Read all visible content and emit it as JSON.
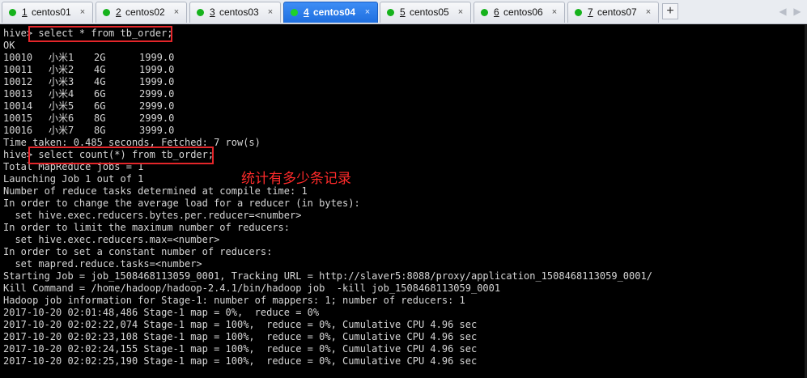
{
  "tabs": [
    {
      "num": "1",
      "name": "centos01",
      "active": false
    },
    {
      "num": "2",
      "name": "centos02",
      "active": false
    },
    {
      "num": "3",
      "name": "centos03",
      "active": false
    },
    {
      "num": "4",
      "name": "centos04",
      "active": true
    },
    {
      "num": "5",
      "name": "centos05",
      "active": false
    },
    {
      "num": "6",
      "name": "centos06",
      "active": false
    },
    {
      "num": "7",
      "name": "centos07",
      "active": false
    }
  ],
  "tab_close_glyph": "×",
  "new_tab_glyph": "+",
  "nav": {
    "left": "◀",
    "right": "▶"
  },
  "terminal": {
    "prompt1": "hive>",
    "query1": " select * from tb_order;",
    "ok": "OK",
    "rows": [
      {
        "id": "10010",
        "name": "小米1",
        "mem": "2G",
        "price": "1999.0"
      },
      {
        "id": "10011",
        "name": "小米2",
        "mem": "4G",
        "price": "1999.0"
      },
      {
        "id": "10012",
        "name": "小米3",
        "mem": "4G",
        "price": "1999.0"
      },
      {
        "id": "10013",
        "name": "小米4",
        "mem": "6G",
        "price": "2999.0"
      },
      {
        "id": "10014",
        "name": "小米5",
        "mem": "6G",
        "price": "2999.0"
      },
      {
        "id": "10015",
        "name": "小米6",
        "mem": "8G",
        "price": "2999.0"
      },
      {
        "id": "10016",
        "name": "小米7",
        "mem": "8G",
        "price": "3999.0"
      }
    ],
    "time_taken": "Time taken: 0.485 seconds, Fetched: 7 row(s)",
    "prompt2": "hive>",
    "query2": " select count(*) from tb_order;",
    "annotation": "统计有多少条记录",
    "output_lines": [
      "Total MapReduce jobs = 1",
      "Launching Job 1 out of 1",
      "Number of reduce tasks determined at compile time: 1",
      "In order to change the average load for a reducer (in bytes):",
      "  set hive.exec.reducers.bytes.per.reducer=<number>",
      "In order to limit the maximum number of reducers:",
      "  set hive.exec.reducers.max=<number>",
      "In order to set a constant number of reducers:",
      "  set mapred.reduce.tasks=<number>",
      "Starting Job = job_1508468113059_0001, Tracking URL = http://slaver5:8088/proxy/application_1508468113059_0001/",
      "Kill Command = /home/hadoop/hadoop-2.4.1/bin/hadoop job  -kill job_1508468113059_0001",
      "Hadoop job information for Stage-1: number of mappers: 1; number of reducers: 1",
      "2017-10-20 02:01:48,486 Stage-1 map = 0%,  reduce = 0%",
      "2017-10-20 02:02:22,074 Stage-1 map = 100%,  reduce = 0%, Cumulative CPU 4.96 sec",
      "2017-10-20 02:02:23,108 Stage-1 map = 100%,  reduce = 0%, Cumulative CPU 4.96 sec",
      "2017-10-20 02:02:24,155 Stage-1 map = 100%,  reduce = 0%, Cumulative CPU 4.96 sec",
      "2017-10-20 02:02:25,190 Stage-1 map = 100%,  reduce = 0%, Cumulative CPU 4.96 sec"
    ]
  },
  "colors": {
    "terminal_bg": "#000000",
    "terminal_fg": "#d6d6d6",
    "highlight": "#e4262a",
    "annotation": "#ff2a2a",
    "active_tab": "#1f6fe0",
    "status_dot": "#16b21c"
  }
}
